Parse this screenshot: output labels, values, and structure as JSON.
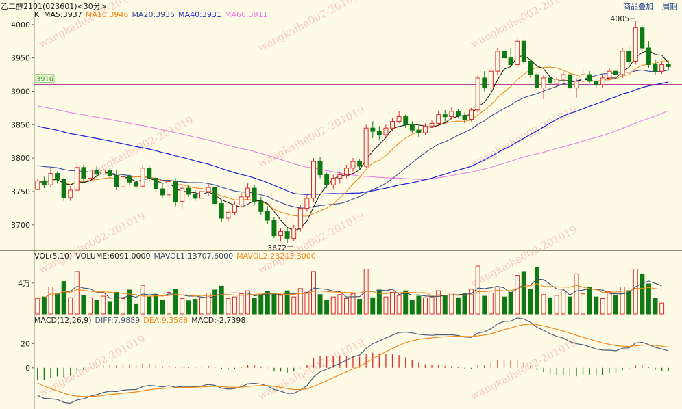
{
  "header": {
    "title": "乙二醇2101(023601)<30分>",
    "links": [
      {
        "label": "商品叠加"
      },
      {
        "label": "周期"
      }
    ]
  },
  "colors": {
    "up": "#e0262a",
    "down": "#0e7a14",
    "ma5": "#111111",
    "ma10": "#f08a18",
    "ma20": "#3a4a9a",
    "ma40": "#1a1fd6",
    "ma60": "#e87ce8",
    "vol_ma1": "#3a4a6a",
    "vol_ma2": "#f08a18",
    "diff": "#4a5a78",
    "dea": "#f08a18",
    "line3910": "#a0288a",
    "background": "#fdfbe6",
    "grid": "#cfcdb4",
    "axis_text": "#222222",
    "watermark": "#f0a0a0"
  },
  "watermark": "wangkaihe002-201019",
  "chart_data": [
    {
      "type": "candlestick",
      "panel": "price",
      "indicator_label": "K",
      "legend": [
        {
          "name": "MA5",
          "value": "3937",
          "color_key": "ma5"
        },
        {
          "name": "MA10",
          "value": "3946",
          "color_key": "ma10"
        },
        {
          "name": "MA20",
          "value": "3935",
          "color_key": "ma20"
        },
        {
          "name": "MA40",
          "value": "3931",
          "color_key": "ma40"
        },
        {
          "name": "MA60",
          "value": "3911",
          "color_key": "ma60"
        }
      ],
      "ylim": [
        3664,
        4008
      ],
      "yticks": [
        3700,
        3750,
        3800,
        3850,
        3900,
        3950,
        4000
      ],
      "annotations": [
        {
          "text": "4005",
          "bar_index": 91,
          "value": 4005,
          "anchor": "high"
        },
        {
          "text": "3672",
          "bar_index": 38,
          "value": 3672,
          "anchor": "low"
        }
      ],
      "reference_line": {
        "value": 3910,
        "label": "3910"
      },
      "ohlc": [
        [
          3753,
          3768,
          3752,
          3766
        ],
        [
          3766,
          3772,
          3755,
          3760
        ],
        [
          3760,
          3785,
          3757,
          3777
        ],
        [
          3777,
          3780,
          3762,
          3768
        ],
        [
          3768,
          3771,
          3736,
          3741
        ],
        [
          3741,
          3758,
          3736,
          3752
        ],
        [
          3752,
          3792,
          3750,
          3786
        ],
        [
          3786,
          3790,
          3764,
          3770
        ],
        [
          3770,
          3788,
          3765,
          3782
        ],
        [
          3782,
          3788,
          3771,
          3776
        ],
        [
          3776,
          3786,
          3772,
          3782
        ],
        [
          3782,
          3785,
          3770,
          3774
        ],
        [
          3774,
          3782,
          3752,
          3757
        ],
        [
          3757,
          3776,
          3755,
          3772
        ],
        [
          3772,
          3776,
          3760,
          3764
        ],
        [
          3764,
          3770,
          3755,
          3758
        ],
        [
          3758,
          3790,
          3756,
          3785
        ],
        [
          3785,
          3788,
          3766,
          3770
        ],
        [
          3770,
          3774,
          3749,
          3754
        ],
        [
          3754,
          3762,
          3740,
          3745
        ],
        [
          3745,
          3770,
          3741,
          3765
        ],
        [
          3765,
          3770,
          3728,
          3735
        ],
        [
          3735,
          3761,
          3724,
          3755
        ],
        [
          3755,
          3760,
          3742,
          3746
        ],
        [
          3746,
          3752,
          3736,
          3740
        ],
        [
          3740,
          3754,
          3737,
          3750
        ],
        [
          3750,
          3762,
          3743,
          3756
        ],
        [
          3756,
          3760,
          3727,
          3732
        ],
        [
          3732,
          3738,
          3705,
          3710
        ],
        [
          3710,
          3722,
          3704,
          3719
        ],
        [
          3719,
          3735,
          3714,
          3730
        ],
        [
          3730,
          3748,
          3726,
          3742
        ],
        [
          3742,
          3762,
          3738,
          3755
        ],
        [
          3755,
          3760,
          3730,
          3735
        ],
        [
          3735,
          3742,
          3715,
          3720
        ],
        [
          3720,
          3728,
          3702,
          3707
        ],
        [
          3707,
          3712,
          3680,
          3684
        ],
        [
          3684,
          3695,
          3675,
          3690
        ],
        [
          3690,
          3695,
          3672,
          3680
        ],
        [
          3680,
          3700,
          3676,
          3695
        ],
        [
          3695,
          3730,
          3690,
          3725
        ],
        [
          3725,
          3745,
          3720,
          3740
        ],
        [
          3740,
          3800,
          3735,
          3795
        ],
        [
          3795,
          3802,
          3770,
          3775
        ],
        [
          3775,
          3778,
          3755,
          3760
        ],
        [
          3760,
          3775,
          3753,
          3770
        ],
        [
          3770,
          3780,
          3762,
          3775
        ],
        [
          3775,
          3790,
          3770,
          3785
        ],
        [
          3785,
          3800,
          3780,
          3795
        ],
        [
          3795,
          3798,
          3782,
          3788
        ],
        [
          3788,
          3850,
          3785,
          3845
        ],
        [
          3845,
          3855,
          3830,
          3840
        ],
        [
          3840,
          3848,
          3828,
          3835
        ],
        [
          3835,
          3850,
          3830,
          3845
        ],
        [
          3845,
          3860,
          3840,
          3855
        ],
        [
          3855,
          3870,
          3852,
          3862
        ],
        [
          3862,
          3865,
          3845,
          3850
        ],
        [
          3850,
          3855,
          3838,
          3842
        ],
        [
          3842,
          3848,
          3832,
          3838
        ],
        [
          3838,
          3852,
          3835,
          3848
        ],
        [
          3848,
          3856,
          3845,
          3852
        ],
        [
          3852,
          3870,
          3848,
          3865
        ],
        [
          3865,
          3872,
          3855,
          3862
        ],
        [
          3862,
          3876,
          3858,
          3870
        ],
        [
          3870,
          3873,
          3860,
          3864
        ],
        [
          3864,
          3868,
          3852,
          3858
        ],
        [
          3858,
          3875,
          3855,
          3872
        ],
        [
          3872,
          3925,
          3868,
          3920
        ],
        [
          3920,
          3930,
          3900,
          3905
        ],
        [
          3905,
          3935,
          3900,
          3930
        ],
        [
          3930,
          3965,
          3925,
          3960
        ],
        [
          3960,
          3968,
          3945,
          3950
        ],
        [
          3950,
          3965,
          3935,
          3940
        ],
        [
          3940,
          3980,
          3935,
          3975
        ],
        [
          3975,
          3978,
          3940,
          3945
        ],
        [
          3945,
          3948,
          3920,
          3925
        ],
        [
          3925,
          3930,
          3900,
          3905
        ],
        [
          3905,
          3925,
          3888,
          3920
        ],
        [
          3920,
          3925,
          3908,
          3912
        ],
        [
          3912,
          3922,
          3905,
          3918
        ],
        [
          3918,
          3930,
          3912,
          3925
        ],
        [
          3925,
          3928,
          3900,
          3905
        ],
        [
          3905,
          3920,
          3890,
          3915
        ],
        [
          3915,
          3935,
          3910,
          3925
        ],
        [
          3925,
          3930,
          3912,
          3915
        ],
        [
          3915,
          3918,
          3905,
          3910
        ],
        [
          3910,
          3925,
          3906,
          3920
        ],
        [
          3920,
          3935,
          3915,
          3930
        ],
        [
          3930,
          3938,
          3920,
          3925
        ],
        [
          3925,
          3965,
          3920,
          3960
        ],
        [
          3960,
          3968,
          3940,
          3945
        ],
        [
          3945,
          4005,
          3940,
          3995
        ],
        [
          3995,
          3998,
          3960,
          3965
        ],
        [
          3965,
          3975,
          3935,
          3940
        ],
        [
          3940,
          3948,
          3925,
          3930
        ],
        [
          3930,
          3944,
          3926,
          3940
        ],
        [
          3940,
          3946,
          3932,
          3937
        ]
      ]
    },
    {
      "type": "bar",
      "panel": "volume",
      "indicator_label": "VOL(5,10)",
      "legend": [
        {
          "name": "VOLUME",
          "value": "6091.0000",
          "color_key": "axis_text"
        },
        {
          "name": "MAVOL1",
          "value": "13707.6000",
          "color_key": "vol_ma1"
        },
        {
          "name": "MAVOL2",
          "value": "23213.3000",
          "color_key": "vol_ma2"
        }
      ],
      "yticks": [
        {
          "value": 40000,
          "label": "4万"
        }
      ],
      "ylim": [
        0,
        70000
      ],
      "values": [
        20000,
        22000,
        35000,
        26000,
        42000,
        21000,
        55000,
        24000,
        21000,
        18000,
        23000,
        16000,
        28000,
        20000,
        31000,
        13000,
        37000,
        22000,
        25000,
        18000,
        28000,
        32000,
        20000,
        17000,
        19000,
        21000,
        27000,
        31000,
        36000,
        20000,
        22000,
        26000,
        30000,
        20000,
        25000,
        29000,
        26000,
        24000,
        30000,
        22000,
        33000,
        28000,
        55000,
        25000,
        18000,
        22000,
        25000,
        20000,
        26000,
        19000,
        58000,
        21000,
        31000,
        22000,
        28000,
        24000,
        30000,
        18000,
        23000,
        21000,
        22000,
        30000,
        24000,
        27000,
        21000,
        26000,
        32000,
        62000,
        23000,
        27000,
        35000,
        22000,
        28000,
        50000,
        55000,
        32000,
        60000,
        25000,
        21000,
        24000,
        30000,
        22000,
        52000,
        26000,
        35000,
        22000,
        20000,
        29000,
        24000,
        35000,
        30000,
        58000,
        51000,
        39000,
        20000,
        14000
      ]
    },
    {
      "type": "macd",
      "panel": "macd",
      "indicator_label": "MACD(12,26,9)",
      "legend": [
        {
          "name": "DIFF",
          "value": "7.9889",
          "color_key": "diff"
        },
        {
          "name": "DEA",
          "value": "9.3588",
          "color_key": "dea"
        },
        {
          "name": "MACD",
          "value": "-2.7398",
          "color_key": "axis_text"
        }
      ],
      "ylim": [
        -34,
        36
      ],
      "yticks": [
        0,
        20
      ]
    }
  ]
}
